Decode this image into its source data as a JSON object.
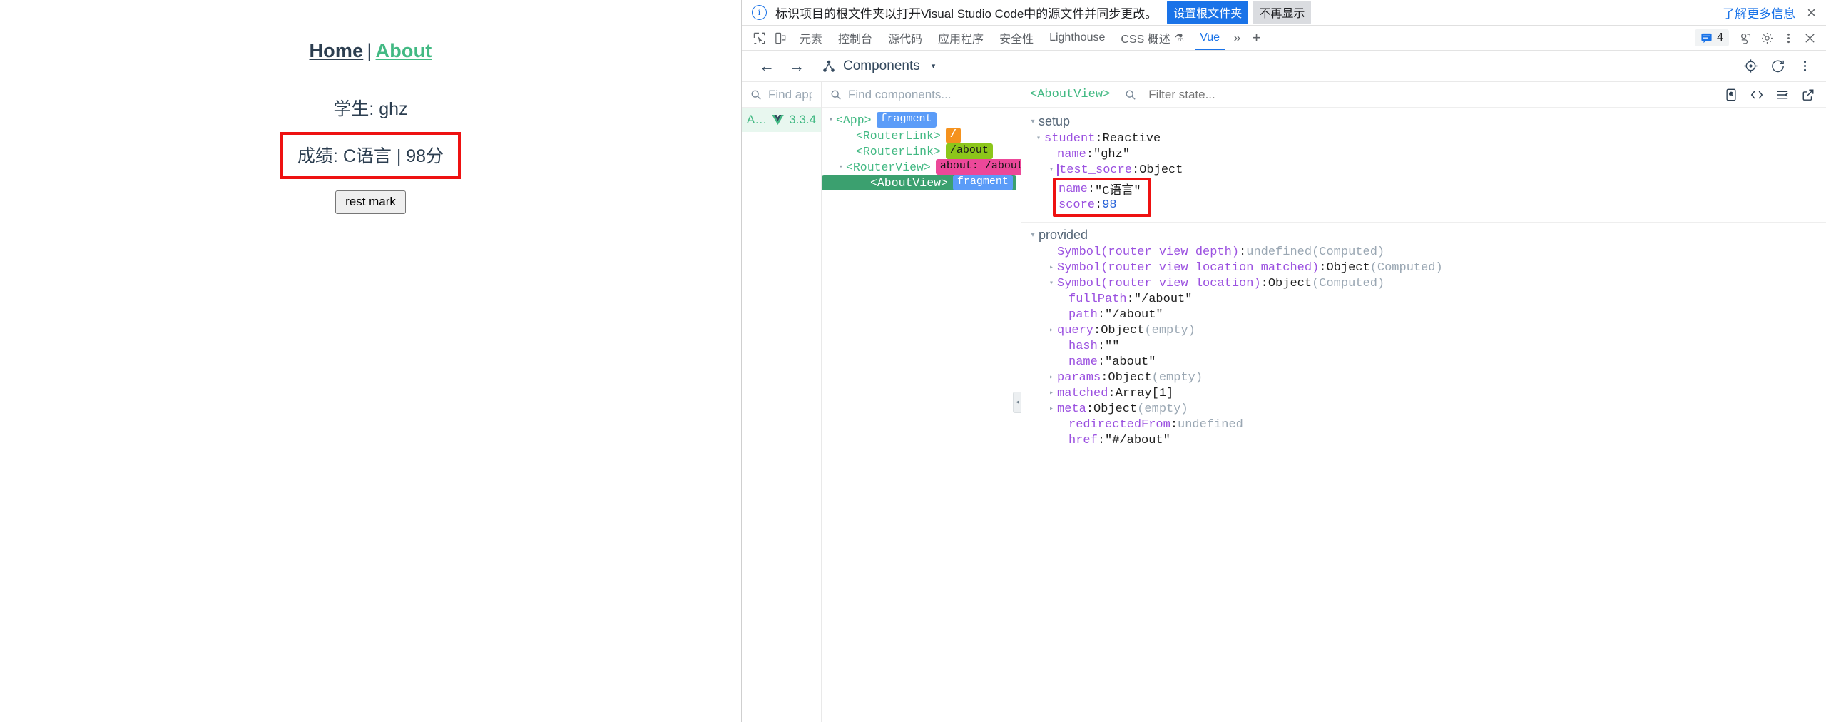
{
  "webpage": {
    "nav": {
      "home": "Home",
      "separator": "|",
      "about": "About"
    },
    "student_line": "学生: ghz",
    "mark_line": "成绩: C语言 | 98分",
    "reset_button": "rest mark",
    "accent_color": "#42b983",
    "highlight_color": "#ee1111"
  },
  "notification": {
    "icon": "info-circle-icon",
    "message": "标识项目的根文件夹以打开Visual Studio Code中的源文件并同步更改。",
    "primary_button": "设置根文件夹",
    "secondary_button": "不再显示",
    "learn_more": "了解更多信息",
    "close": "×",
    "primary_color": "#1a73e8"
  },
  "devtools_tabs": {
    "left_icons": [
      "inspect-element-icon",
      "device-toolbar-icon"
    ],
    "tabs": [
      {
        "label": "元素",
        "selected": false
      },
      {
        "label": "控制台",
        "selected": false
      },
      {
        "label": "源代码",
        "selected": false
      },
      {
        "label": "应用程序",
        "selected": false
      },
      {
        "label": "安全性",
        "selected": false
      },
      {
        "label": "Lighthouse",
        "selected": false
      },
      {
        "label": "CSS 概述",
        "selected": false,
        "experimental": true
      },
      {
        "label": "Vue",
        "selected": true
      }
    ],
    "overflow": "»",
    "add_tab": "+",
    "issues_count": "4",
    "right_icons": [
      "issues-icon",
      "cloud-devtools-icon",
      "settings-gear-icon",
      "more-options-icon",
      "close-devtools-icon"
    ],
    "selected_color": "#1a73e8"
  },
  "vue_toolbar": {
    "back": "←",
    "forward": "→",
    "view_icon": "component-tree-icon",
    "view_label": "Components",
    "view_caret": "▾",
    "right_icons": [
      "target-icon",
      "refresh-icon",
      "more-vertical-icon"
    ]
  },
  "apps_pane": {
    "search_placeholder": "Find app",
    "search_value": "",
    "apps": [
      {
        "name": "A…",
        "vue_logo": "vue-logo-icon",
        "version": "3.3.4",
        "selected": true
      }
    ]
  },
  "tree_pane": {
    "search_placeholder": "Find components...",
    "search_value": "",
    "nodes": [
      {
        "depth": 0,
        "twisty": "▾",
        "tag": "<App>",
        "badge": "fragment",
        "badge_kind": "fragment",
        "selected": false
      },
      {
        "depth": 1,
        "twisty": "",
        "tag": "<RouterLink>",
        "badge": "/",
        "badge_kind": "orange",
        "selected": false
      },
      {
        "depth": 1,
        "twisty": "",
        "tag": "<RouterLink>",
        "badge": "/about",
        "badge_kind": "green",
        "selected": false
      },
      {
        "depth": 1,
        "twisty": "▾",
        "tag": "<RouterView>",
        "badge": "about: /about",
        "badge_kind": "pink",
        "selected": false
      },
      {
        "depth": 2,
        "twisty": "",
        "tag": "<AboutView>",
        "badge": "fragment",
        "badge_kind": "fragment",
        "selected": true
      }
    ],
    "collapse_handle": "◂"
  },
  "state_pane": {
    "component_name": "<AboutView>",
    "filter_placeholder": "Filter state...",
    "filter_value": "",
    "header_icons": [
      "inspect-dom-icon",
      "open-source-code-icon",
      "console-ref-icon",
      "open-external-icon"
    ],
    "groups": [
      {
        "title": "setup",
        "twisty": "▾",
        "rows": [
          {
            "indent": 1,
            "twisty": "▾",
            "key": "student",
            "sep": ": ",
            "value": "Reactive",
            "kind": "type"
          },
          {
            "indent": 2,
            "twisty": "",
            "key": "name",
            "sep": ": ",
            "value": "\"ghz\"",
            "kind": "str"
          },
          {
            "indent": 2,
            "twisty": "▾",
            "key": "test_socre",
            "sep": ": ",
            "value": "Object",
            "kind": "type",
            "caret": true
          }
        ],
        "highlight_box": {
          "rows": [
            {
              "key": "name",
              "sep": ": ",
              "value": "\"C语言\"",
              "kind": "str"
            },
            {
              "key": "score",
              "sep": ": ",
              "value": "98",
              "kind": "num"
            }
          ]
        }
      },
      {
        "title": "provided",
        "twisty": "▾",
        "rows": [
          {
            "indent": 1,
            "twisty": "",
            "key": "Symbol(router view depth)",
            "sep": ": ",
            "value": "undefined",
            "kind": "undef",
            "note": " (Computed)"
          },
          {
            "indent": 1,
            "twisty": "▸",
            "key": "Symbol(router view location matched)",
            "sep": ": ",
            "value": "Object",
            "kind": "type",
            "note": " (Computed)"
          },
          {
            "indent": 1,
            "twisty": "▾",
            "key": "Symbol(router view location)",
            "sep": ": ",
            "value": "Object",
            "kind": "type",
            "note": " (Computed)"
          },
          {
            "indent": 2,
            "twisty": "",
            "key": "fullPath",
            "sep": ": ",
            "value": "\"/about\"",
            "kind": "str"
          },
          {
            "indent": 2,
            "twisty": "",
            "key": "path",
            "sep": ": ",
            "value": "\"/about\"",
            "kind": "str"
          },
          {
            "indent": 2,
            "twisty": "▸",
            "key": "query",
            "sep": ": ",
            "value": "Object",
            "kind": "type",
            "note": " (empty)"
          },
          {
            "indent": 2,
            "twisty": "",
            "key": "hash",
            "sep": ": ",
            "value": "\"\"",
            "kind": "str"
          },
          {
            "indent": 2,
            "twisty": "",
            "key": "name",
            "sep": ": ",
            "value": "\"about\"",
            "kind": "str"
          },
          {
            "indent": 2,
            "twisty": "▸",
            "key": "params",
            "sep": ": ",
            "value": "Object",
            "kind": "type",
            "note": " (empty)"
          },
          {
            "indent": 2,
            "twisty": "▸",
            "key": "matched",
            "sep": ": ",
            "value": "Array[1]",
            "kind": "type"
          },
          {
            "indent": 2,
            "twisty": "▸",
            "key": "meta",
            "sep": ": ",
            "value": "Object",
            "kind": "type",
            "note": " (empty)"
          },
          {
            "indent": 2,
            "twisty": "",
            "key": "redirectedFrom",
            "sep": ": ",
            "value": "undefined",
            "kind": "undef"
          },
          {
            "indent": 2,
            "twisty": "",
            "key": "href",
            "sep": ": ",
            "value": "\"#/about\"",
            "kind": "str"
          }
        ]
      }
    ]
  }
}
